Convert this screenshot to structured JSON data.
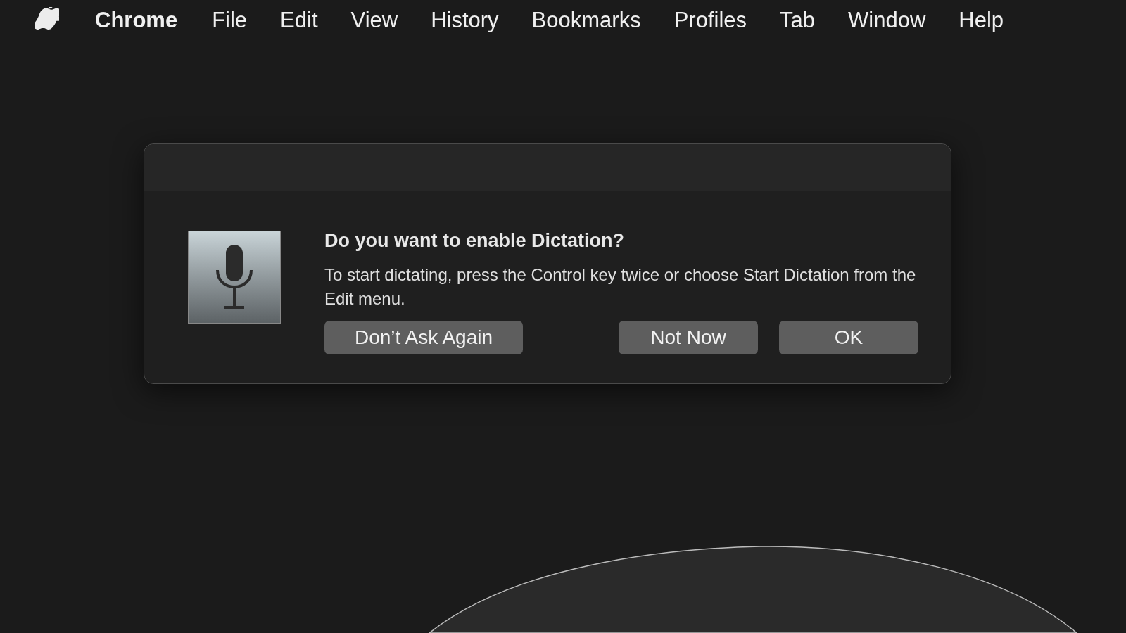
{
  "menu_bar": {
    "app_name": "Chrome",
    "items": [
      "File",
      "Edit",
      "View",
      "History",
      "Bookmarks",
      "Profiles",
      "Tab",
      "Window",
      "Help"
    ]
  },
  "dialog": {
    "title": "Do you want to enable Dictation?",
    "message": "To start dictating, press the Control key twice or choose Start Dictation from the Edit menu.",
    "buttons": [
      {
        "label": "Don’t Ask Again",
        "kind": "secondary"
      },
      {
        "label": "Not Now",
        "kind": "cancel"
      },
      {
        "label": "OK",
        "kind": "default"
      }
    ]
  }
}
